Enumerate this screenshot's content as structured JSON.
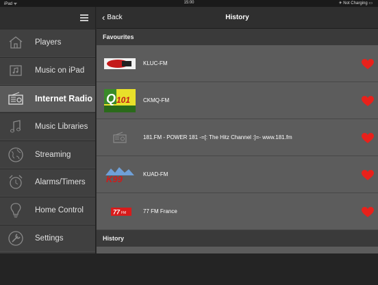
{
  "status_bar": {
    "carrier": "iPad ᯤ",
    "time": "15:00",
    "battery": "✈ Not Charging ▭"
  },
  "sidebar": {
    "items": [
      {
        "label": "Players",
        "icon": "house-icon"
      },
      {
        "label": "Music on iPad",
        "icon": "music-on-ipad-icon"
      },
      {
        "label": "Internet Radio",
        "icon": "radio-icon",
        "active": true
      },
      {
        "label": "Music Libraries",
        "icon": "music-note-icon"
      },
      {
        "label": "Streaming",
        "icon": "globe-icon"
      },
      {
        "label": "Alarms/Timers",
        "icon": "alarm-clock-icon"
      },
      {
        "label": "Home Control",
        "icon": "lightbulb-icon"
      },
      {
        "label": "Settings",
        "icon": "settings-icon"
      }
    ]
  },
  "navbar": {
    "back_label": "Back",
    "title": "History"
  },
  "sections": {
    "favourites": {
      "title": "Favourites",
      "rows": [
        {
          "label": "KLUC-FM",
          "logo": "kluc-logo"
        },
        {
          "label": "CKMQ-FM",
          "logo": "q101-logo"
        },
        {
          "label": "181.FM - POWER 181 -=[: The Hitz Channel :]=- www.181.fm",
          "logo": "radio-placeholder-icon"
        },
        {
          "label": "KUAD-FM",
          "logo": "k99-logo"
        },
        {
          "label": "77 FM France",
          "logo": "77fm-logo"
        }
      ]
    },
    "history": {
      "title": "History"
    }
  },
  "colors": {
    "heart": "#e8211b",
    "active_item": "#5a5a5a"
  }
}
